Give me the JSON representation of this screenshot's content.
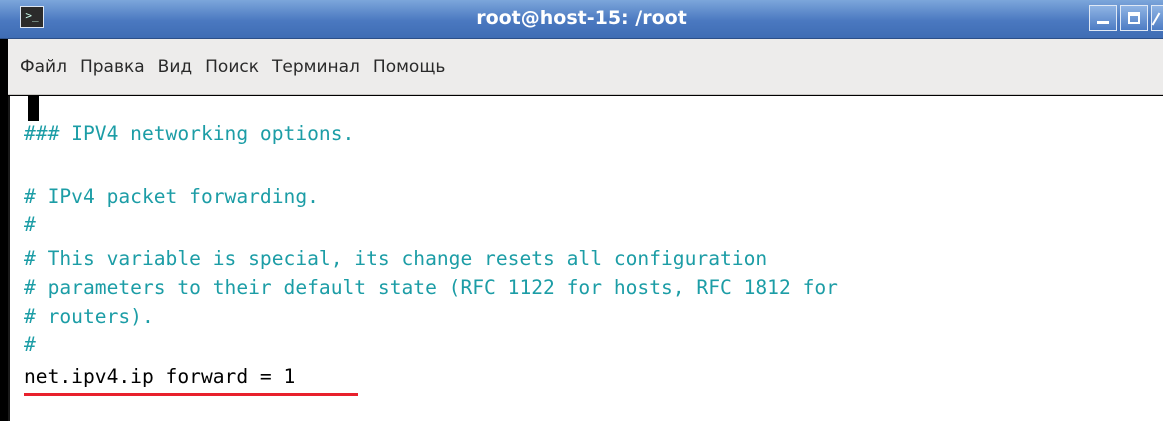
{
  "window": {
    "title": "root@host-15: /root",
    "app_icon_glyph": ">_"
  },
  "menu": {
    "items": [
      {
        "label": "Файл"
      },
      {
        "label": "Правка"
      },
      {
        "label": "Вид"
      },
      {
        "label": "Поиск"
      },
      {
        "label": "Терминал"
      },
      {
        "label": "Помощь"
      }
    ]
  },
  "terminal": {
    "lines": [
      {
        "text": "### IPV4 networking options.",
        "kind": "comment"
      },
      {
        "text": "# IPv4 packet forwarding.",
        "kind": "comment"
      },
      {
        "text": "#",
        "kind": "comment"
      },
      {
        "text": "# This variable is special, its change resets all configuration",
        "kind": "comment"
      },
      {
        "text": "# parameters to their default state (RFC 1122 for hosts, RFC 1812 for",
        "kind": "comment"
      },
      {
        "text": "# routers).",
        "kind": "comment"
      },
      {
        "text": "#",
        "kind": "comment"
      },
      {
        "text": "net.ipv4.ip forward = 1",
        "kind": "setting"
      }
    ]
  },
  "colors": {
    "comment": "#1c9da6",
    "setting": "#000000",
    "highlight_underline": "#e8202c",
    "titlebar": "#4a78c0"
  }
}
